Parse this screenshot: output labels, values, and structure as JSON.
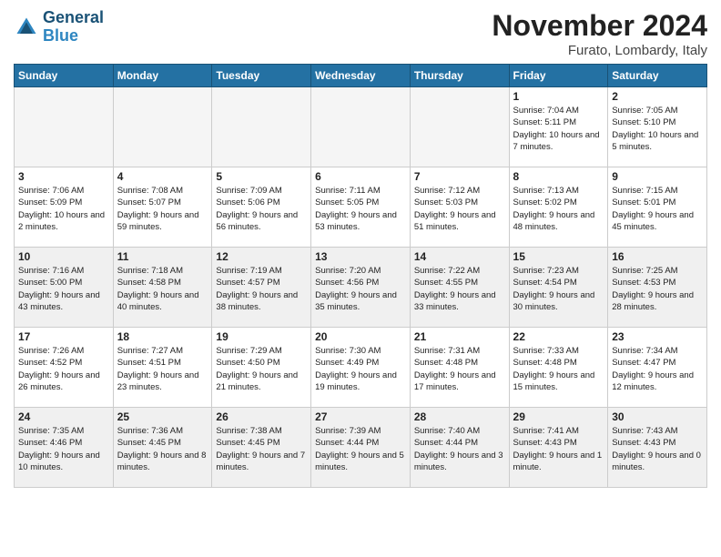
{
  "header": {
    "logo_line1": "General",
    "logo_line2": "Blue",
    "month_title": "November 2024",
    "location": "Furato, Lombardy, Italy"
  },
  "weekdays": [
    "Sunday",
    "Monday",
    "Tuesday",
    "Wednesday",
    "Thursday",
    "Friday",
    "Saturday"
  ],
  "weeks": [
    [
      {
        "day": "",
        "info": "",
        "empty": true
      },
      {
        "day": "",
        "info": "",
        "empty": true
      },
      {
        "day": "",
        "info": "",
        "empty": true
      },
      {
        "day": "",
        "info": "",
        "empty": true
      },
      {
        "day": "",
        "info": "",
        "empty": true
      },
      {
        "day": "1",
        "info": "Sunrise: 7:04 AM\nSunset: 5:11 PM\nDaylight: 10 hours and 7 minutes.",
        "empty": false
      },
      {
        "day": "2",
        "info": "Sunrise: 7:05 AM\nSunset: 5:10 PM\nDaylight: 10 hours and 5 minutes.",
        "empty": false
      }
    ],
    [
      {
        "day": "3",
        "info": "Sunrise: 7:06 AM\nSunset: 5:09 PM\nDaylight: 10 hours and 2 minutes.",
        "empty": false
      },
      {
        "day": "4",
        "info": "Sunrise: 7:08 AM\nSunset: 5:07 PM\nDaylight: 9 hours and 59 minutes.",
        "empty": false
      },
      {
        "day": "5",
        "info": "Sunrise: 7:09 AM\nSunset: 5:06 PM\nDaylight: 9 hours and 56 minutes.",
        "empty": false
      },
      {
        "day": "6",
        "info": "Sunrise: 7:11 AM\nSunset: 5:05 PM\nDaylight: 9 hours and 53 minutes.",
        "empty": false
      },
      {
        "day": "7",
        "info": "Sunrise: 7:12 AM\nSunset: 5:03 PM\nDaylight: 9 hours and 51 minutes.",
        "empty": false
      },
      {
        "day": "8",
        "info": "Sunrise: 7:13 AM\nSunset: 5:02 PM\nDaylight: 9 hours and 48 minutes.",
        "empty": false
      },
      {
        "day": "9",
        "info": "Sunrise: 7:15 AM\nSunset: 5:01 PM\nDaylight: 9 hours and 45 minutes.",
        "empty": false
      }
    ],
    [
      {
        "day": "10",
        "info": "Sunrise: 7:16 AM\nSunset: 5:00 PM\nDaylight: 9 hours and 43 minutes.",
        "empty": false
      },
      {
        "day": "11",
        "info": "Sunrise: 7:18 AM\nSunset: 4:58 PM\nDaylight: 9 hours and 40 minutes.",
        "empty": false
      },
      {
        "day": "12",
        "info": "Sunrise: 7:19 AM\nSunset: 4:57 PM\nDaylight: 9 hours and 38 minutes.",
        "empty": false
      },
      {
        "day": "13",
        "info": "Sunrise: 7:20 AM\nSunset: 4:56 PM\nDaylight: 9 hours and 35 minutes.",
        "empty": false
      },
      {
        "day": "14",
        "info": "Sunrise: 7:22 AM\nSunset: 4:55 PM\nDaylight: 9 hours and 33 minutes.",
        "empty": false
      },
      {
        "day": "15",
        "info": "Sunrise: 7:23 AM\nSunset: 4:54 PM\nDaylight: 9 hours and 30 minutes.",
        "empty": false
      },
      {
        "day": "16",
        "info": "Sunrise: 7:25 AM\nSunset: 4:53 PM\nDaylight: 9 hours and 28 minutes.",
        "empty": false
      }
    ],
    [
      {
        "day": "17",
        "info": "Sunrise: 7:26 AM\nSunset: 4:52 PM\nDaylight: 9 hours and 26 minutes.",
        "empty": false
      },
      {
        "day": "18",
        "info": "Sunrise: 7:27 AM\nSunset: 4:51 PM\nDaylight: 9 hours and 23 minutes.",
        "empty": false
      },
      {
        "day": "19",
        "info": "Sunrise: 7:29 AM\nSunset: 4:50 PM\nDaylight: 9 hours and 21 minutes.",
        "empty": false
      },
      {
        "day": "20",
        "info": "Sunrise: 7:30 AM\nSunset: 4:49 PM\nDaylight: 9 hours and 19 minutes.",
        "empty": false
      },
      {
        "day": "21",
        "info": "Sunrise: 7:31 AM\nSunset: 4:48 PM\nDaylight: 9 hours and 17 minutes.",
        "empty": false
      },
      {
        "day": "22",
        "info": "Sunrise: 7:33 AM\nSunset: 4:48 PM\nDaylight: 9 hours and 15 minutes.",
        "empty": false
      },
      {
        "day": "23",
        "info": "Sunrise: 7:34 AM\nSunset: 4:47 PM\nDaylight: 9 hours and 12 minutes.",
        "empty": false
      }
    ],
    [
      {
        "day": "24",
        "info": "Sunrise: 7:35 AM\nSunset: 4:46 PM\nDaylight: 9 hours and 10 minutes.",
        "empty": false
      },
      {
        "day": "25",
        "info": "Sunrise: 7:36 AM\nSunset: 4:45 PM\nDaylight: 9 hours and 8 minutes.",
        "empty": false
      },
      {
        "day": "26",
        "info": "Sunrise: 7:38 AM\nSunset: 4:45 PM\nDaylight: 9 hours and 7 minutes.",
        "empty": false
      },
      {
        "day": "27",
        "info": "Sunrise: 7:39 AM\nSunset: 4:44 PM\nDaylight: 9 hours and 5 minutes.",
        "empty": false
      },
      {
        "day": "28",
        "info": "Sunrise: 7:40 AM\nSunset: 4:44 PM\nDaylight: 9 hours and 3 minutes.",
        "empty": false
      },
      {
        "day": "29",
        "info": "Sunrise: 7:41 AM\nSunset: 4:43 PM\nDaylight: 9 hours and 1 minute.",
        "empty": false
      },
      {
        "day": "30",
        "info": "Sunrise: 7:43 AM\nSunset: 4:43 PM\nDaylight: 9 hours and 0 minutes.",
        "empty": false
      }
    ]
  ]
}
